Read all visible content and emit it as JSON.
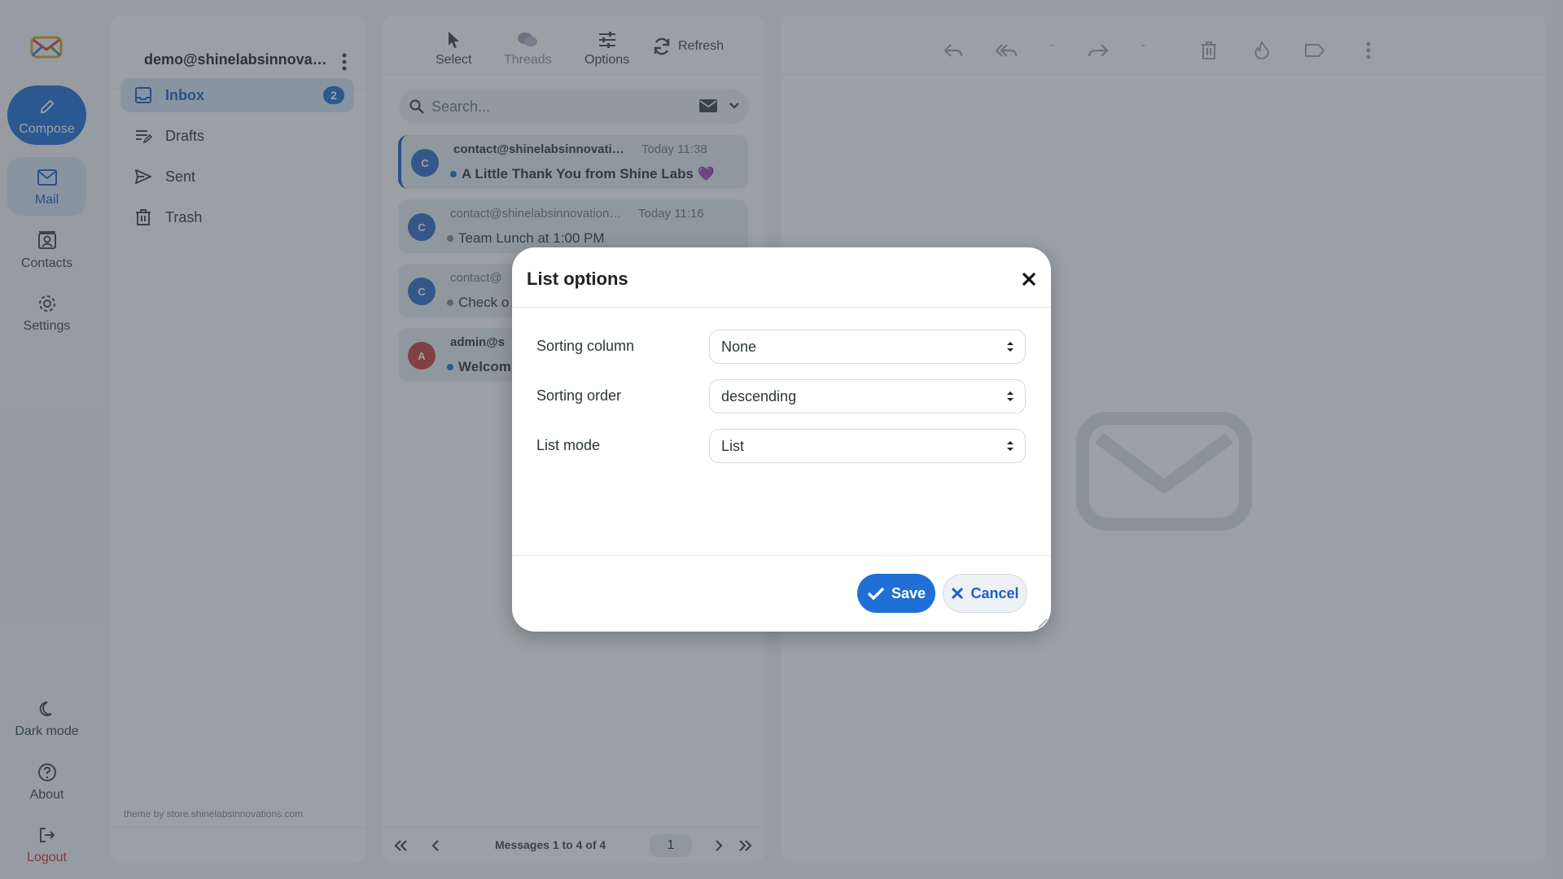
{
  "colors": {
    "accent": "#1f6fd6",
    "active_bg": "#d8e6f7",
    "logout": "#c0392b",
    "avatar_c": "#2f6ec4",
    "avatar_a": "#c8413a"
  },
  "rail": {
    "compose": "Compose",
    "mail": "Mail",
    "contacts": "Contacts",
    "settings": "Settings",
    "dark_mode": "Dark mode",
    "about": "About",
    "logout": "Logout"
  },
  "folders": {
    "account": "demo@shinelabsinnovations.com",
    "items": [
      {
        "label": "Inbox",
        "icon": "inbox-icon",
        "badge": "2"
      },
      {
        "label": "Drafts",
        "icon": "drafts-icon"
      },
      {
        "label": "Sent",
        "icon": "sent-icon"
      },
      {
        "label": "Trash",
        "icon": "trash-icon"
      }
    ],
    "theme_note": "theme by store.shinelabsinnovations.com"
  },
  "toolbar": {
    "select": "Select",
    "threads": "Threads",
    "options": "Options",
    "refresh": "Refresh"
  },
  "search": {
    "placeholder": "Search..."
  },
  "messages": [
    {
      "avatar": "C",
      "from": "contact@shinelabsinnovations.com",
      "time": "Today 11:38",
      "subject": "A Little Thank You from Shine Labs 💜",
      "unread": true
    },
    {
      "avatar": "C",
      "from": "contact@shinelabsinnovations.com",
      "time": "Today 11:16",
      "subject": "Team Lunch at 1:00 PM",
      "unread": false
    },
    {
      "avatar": "C",
      "from": "contact@",
      "time": "",
      "subject": "Check o",
      "unread": false
    },
    {
      "avatar": "A",
      "from": "admin@s",
      "time": "",
      "subject": "Welcom",
      "unread": true
    }
  ],
  "pager": {
    "count": "Messages 1 to 4 of 4",
    "page": "1"
  },
  "reader": {
    "dash1": "-",
    "dash2": "-"
  },
  "dialog": {
    "title": "List options",
    "fields": [
      {
        "label": "Sorting column",
        "value": "None"
      },
      {
        "label": "Sorting order",
        "value": "descending"
      },
      {
        "label": "List mode",
        "value": "List"
      }
    ],
    "save": "Save",
    "cancel": "Cancel"
  }
}
